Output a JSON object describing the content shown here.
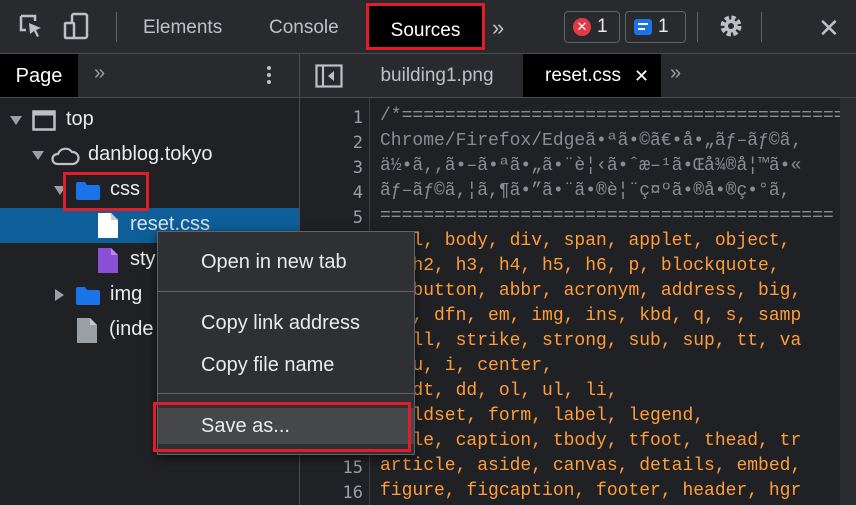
{
  "toolbar": {
    "tabs": [
      "Elements",
      "Console",
      "Sources"
    ],
    "more": "»",
    "error_count": "1",
    "message_count": "1",
    "error_glyph": "✕",
    "close_glyph": "✕"
  },
  "navigator": {
    "tab": "Page",
    "more": "»",
    "tree": {
      "top": "top",
      "domain": "danblog.tokyo",
      "css": "css",
      "reset": "reset.css",
      "sty": "sty",
      "img": "img",
      "index": "(inde"
    }
  },
  "editor": {
    "tabs": [
      "building1.png",
      "reset.css"
    ],
    "close_glyph": "✕",
    "more": "»",
    "line_numbers": [
      "1",
      "2",
      "3",
      "4",
      "5",
      "",
      "",
      "",
      "",
      "",
      "",
      "",
      "",
      "",
      "15",
      "16"
    ],
    "lines": [
      "/*==========================================",
      "Chrome/Firefox/Edgeã•ªã•©ã€•å•„ãƒ–ãƒ©ã‚",
      "ä½•ã,,ã•–ã•ªã•„ã•¨è¦‹ã•ˆæ–¹ã•Œå¾®å¦™ã•«",
      "ãƒ–ãƒ©ã,¦ã,¶ã•”ã•¨ã•®è¦¨ç¤ºã•®å•®ç•°ã,",
      "==========================================",
      "   l, body, div, span, applet, object,",
      "   h2, h3, h4, h5, h6, p, blockquote,",
      "   button, abbr, acronym, address, big,",
      "   , dfn, em, img, ins, kbd, q, s, samp",
      "   ll, strike, strong, sub, sup, tt, va",
      "   u, i, center,",
      "   dt, dd, ol, ul, li,",
      "   ldset, form, label, legend,",
      "   le, caption, tbody, tfoot, thead, tr",
      "article, aside, canvas, details, embed,",
      "figure, figcaption, footer, header, hgr"
    ]
  },
  "context_menu": {
    "open_new_tab": "Open in new tab",
    "copy_link": "Copy link address",
    "copy_name": "Copy file name",
    "save_as": "Save as..."
  },
  "colors": {
    "highlight": "#e11d2b",
    "selected_row": "#0e5e99",
    "folder": "#1a73e8",
    "code_keyword": "#ff9d3b"
  }
}
